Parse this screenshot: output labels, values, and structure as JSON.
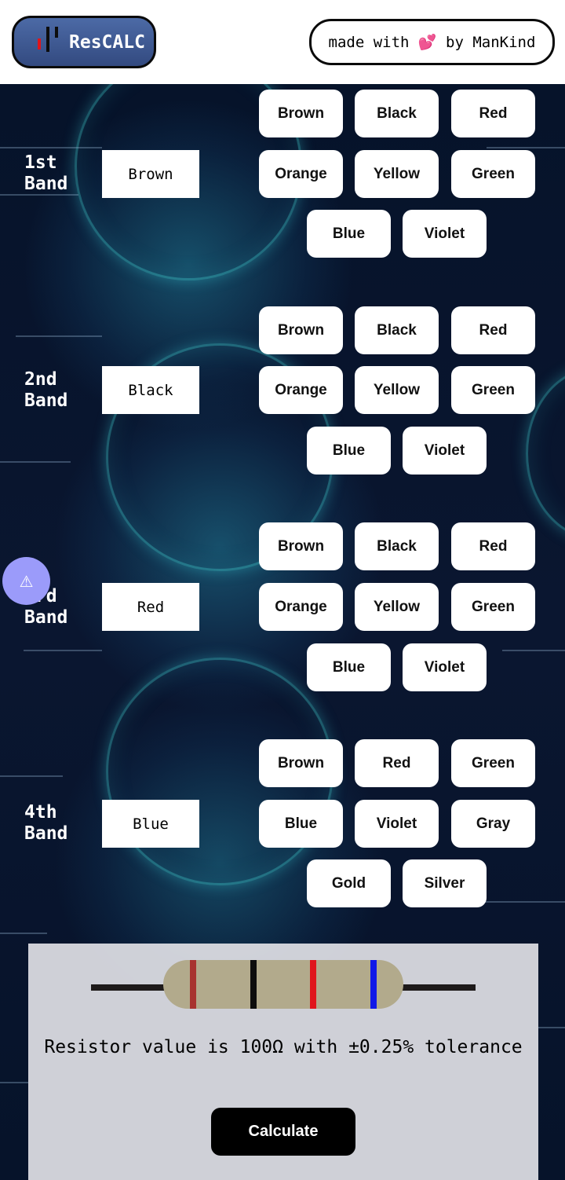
{
  "header": {
    "logo_text": "ResCALC",
    "made_with_text": "made with 💕 by ManKind"
  },
  "bands": [
    {
      "label_line1": "1st",
      "label_line2": "Band",
      "selected": "Brown",
      "options": [
        "Brown",
        "Black",
        "Red",
        "Orange",
        "Yellow",
        "Green",
        "Blue",
        "Violet"
      ]
    },
    {
      "label_line1": "2nd",
      "label_line2": "Band",
      "selected": "Black",
      "options": [
        "Brown",
        "Black",
        "Red",
        "Orange",
        "Yellow",
        "Green",
        "Blue",
        "Violet"
      ]
    },
    {
      "label_line1": "3rd",
      "label_line2": "Band",
      "selected": "Red",
      "options": [
        "Brown",
        "Black",
        "Red",
        "Orange",
        "Yellow",
        "Green",
        "Blue",
        "Violet"
      ]
    },
    {
      "label_line1": "4th",
      "label_line2": "Band",
      "selected": "Blue",
      "options": [
        "Brown",
        "Red",
        "Green",
        "Blue",
        "Violet",
        "Gray",
        "Gold",
        "Silver"
      ]
    }
  ],
  "warning_icon": "⚠",
  "result": {
    "text": "Resistor value is 100Ω with ±0.25% tolerance",
    "calculate_label": "Calculate"
  },
  "resistor_stripe_colors": [
    "#a8332f",
    "#0d0d0d",
    "#e0151b",
    "#1018e8"
  ],
  "colors": {
    "logo_bg": "#3f5a94",
    "button_bg": "#ffffff",
    "calculate_bg": "#000000",
    "warning_bg": "#9b9bfa"
  }
}
